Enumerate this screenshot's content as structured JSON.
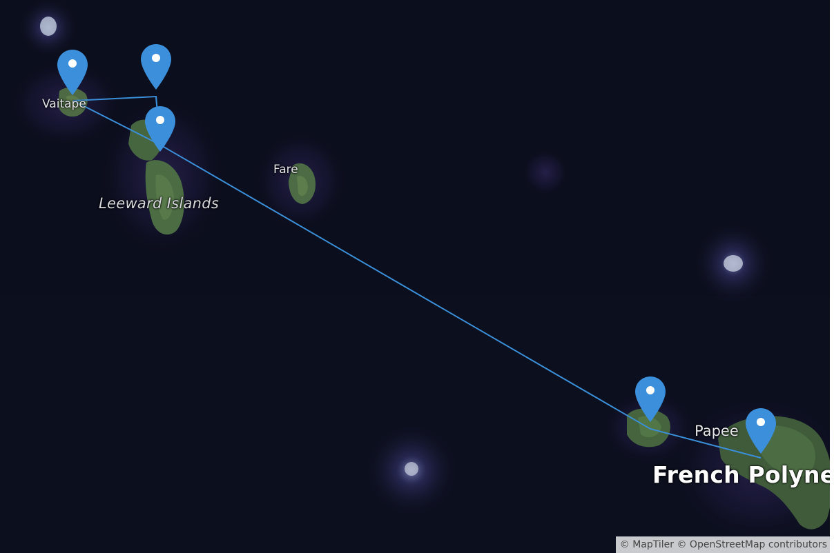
{
  "map": {
    "labels": {
      "vaitape": "Vaitape",
      "fare": "Fare",
      "leeward_islands": "Leeward Islands",
      "papeete": "Papee",
      "country": "French Polyne"
    },
    "attribution": {
      "maptiler": "© MapTiler",
      "osm": "© OpenStreetMap contributors"
    },
    "route_color": "#3a8fd8",
    "marker_color": "#3b8fdb",
    "marker_count": 5
  }
}
